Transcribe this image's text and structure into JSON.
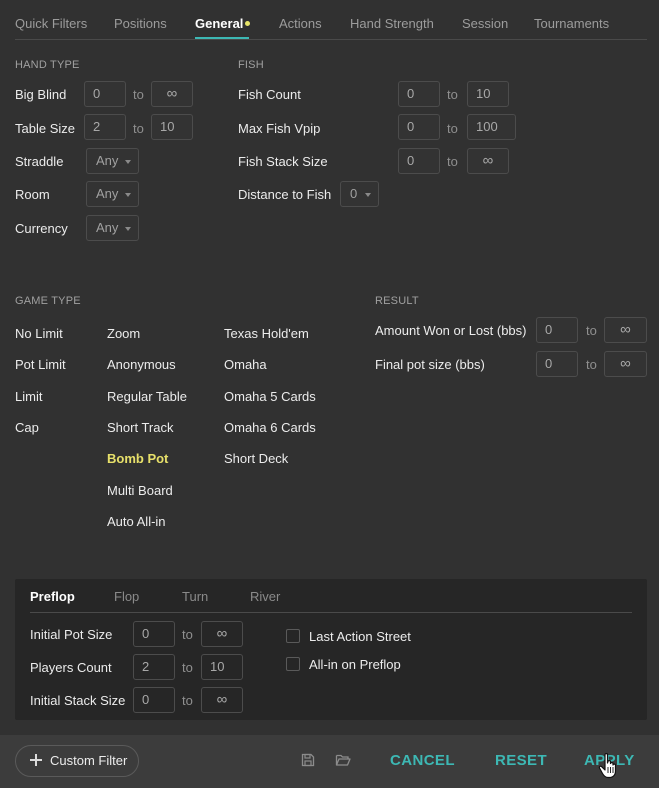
{
  "tabs": [
    "Quick Filters",
    "Positions",
    "General",
    "Actions",
    "Hand Strength",
    "Session",
    "Tournaments"
  ],
  "hand_type": {
    "title": "HAND TYPE",
    "big_blind": {
      "label": "Big Blind",
      "from": "0",
      "to": "∞"
    },
    "table_size": {
      "label": "Table Size",
      "from": "2",
      "to": "10"
    },
    "straddle": {
      "label": "Straddle",
      "value": "Any"
    },
    "room": {
      "label": "Room",
      "value": "Any"
    },
    "currency": {
      "label": "Currency",
      "value": "Any"
    }
  },
  "fish": {
    "title": "FISH",
    "fish_count": {
      "label": "Fish Count",
      "from": "0",
      "to": "10"
    },
    "max_fish_vpip": {
      "label": "Max Fish Vpip",
      "from": "0",
      "to": "100"
    },
    "fish_stack_size": {
      "label": "Fish Stack Size",
      "from": "0",
      "to": "∞"
    },
    "distance_to_fish": {
      "label": "Distance to Fish",
      "value": "0"
    }
  },
  "to_word": "to",
  "game_type": {
    "title": "GAME TYPE",
    "col1": [
      "No Limit",
      "Pot Limit",
      "Limit",
      "Cap"
    ],
    "col2": [
      "Zoom",
      "Anonymous",
      "Regular Table",
      "Short Track",
      "Bomb Pot",
      "Multi Board",
      "Auto All-in"
    ],
    "col3": [
      "Texas Hold'em",
      "Omaha",
      "Omaha 5 Cards",
      "Omaha 6 Cards",
      "Short Deck"
    ]
  },
  "result": {
    "title": "RESULT",
    "amount_won": {
      "label": "Amount Won or Lost (bbs)",
      "from": "0",
      "to": "∞"
    },
    "final_pot": {
      "label": "Final pot size (bbs)",
      "from": "0",
      "to": "∞"
    }
  },
  "street_tabs": [
    "Preflop",
    "Flop",
    "Turn",
    "River"
  ],
  "street": {
    "initial_pot": {
      "label": "Initial Pot Size",
      "from": "0",
      "to": "∞"
    },
    "players_count": {
      "label": "Players Count",
      "from": "2",
      "to": "10"
    },
    "initial_stack": {
      "label": "Initial Stack Size",
      "from": "0",
      "to": "∞"
    },
    "last_action_street": "Last Action Street",
    "allin_preflop": "All-in on Preflop"
  },
  "footer": {
    "custom_filter": "Custom Filter",
    "cancel": "CANCEL",
    "reset": "RESET",
    "apply": "APPLY"
  },
  "colors": {
    "accent": "#3db8b4",
    "highlight": "#e7e06a",
    "background": "#313131"
  }
}
